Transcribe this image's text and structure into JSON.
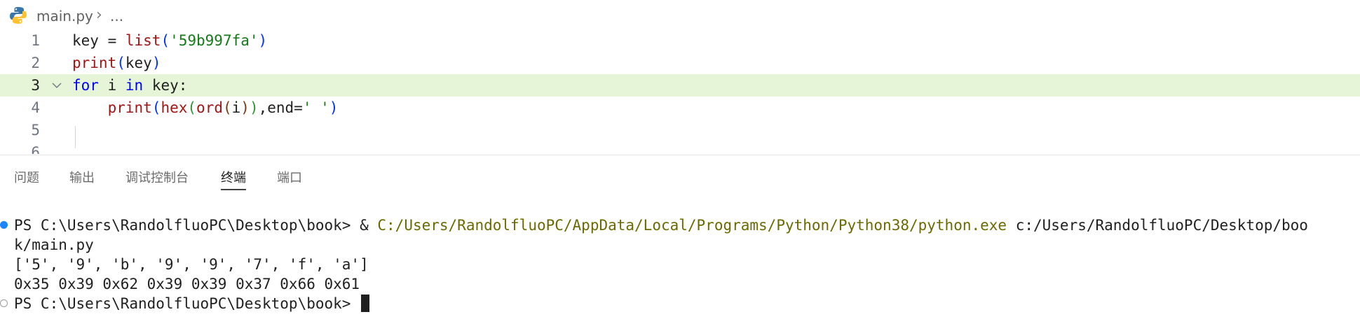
{
  "breadcrumb": {
    "file": "main.py",
    "more": "..."
  },
  "editor": {
    "lines": [
      {
        "number": "1",
        "code": "key = list('59b997fa')"
      },
      {
        "number": "2",
        "code": "print(key)"
      },
      {
        "number": "3",
        "code": "for i in key:"
      },
      {
        "number": "4",
        "code": "    print(hex(ord(i)),end=' ')"
      },
      {
        "number": "5",
        "code": ""
      },
      {
        "number": "6",
        "code": ""
      }
    ],
    "current_line": "3"
  },
  "panel": {
    "tabs": [
      "问题",
      "输出",
      "调试控制台",
      "终端",
      "端口"
    ],
    "active_tab": "终端"
  },
  "terminal": {
    "prompt1": "PS C:\\Users\\RandolfluoPC\\Desktop\\book> ",
    "amp": "& ",
    "exe_path": "C:/Users/RandolfluoPC/AppData/Local/Programs/Python/Python38/python.exe",
    "arg1": " c:/Users/RandolfluoPC/Desktop/boo",
    "arg2": "k/main.py",
    "output1": "['5', '9', 'b', '9', '9', '7', 'f', 'a']",
    "output2": "0x35 0x39 0x62 0x39 0x39 0x37 0x66 0x61",
    "prompt2": "PS C:\\Users\\RandolfluoPC\\Desktop\\book> "
  },
  "icons": [
    "python-icon",
    "chevron-right-icon",
    "fold-chevron-icon",
    "terminal-cursor"
  ],
  "colors": {
    "current_line": "#e6f5d8",
    "keyword": "#0000ff",
    "function": "#a31515",
    "string": "#137a17",
    "status_dot": "#1a85ff"
  }
}
